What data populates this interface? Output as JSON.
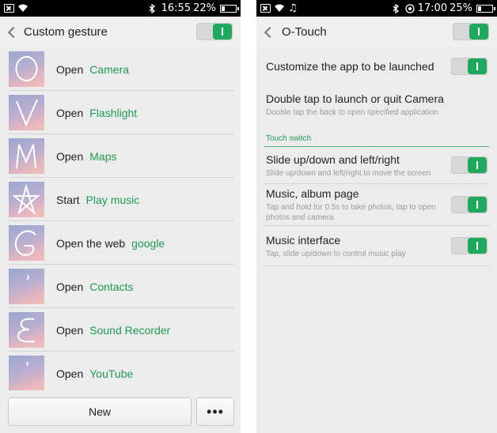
{
  "left": {
    "status": {
      "time": "16:55",
      "battery": "22%",
      "battery_level": 0.22
    },
    "header": {
      "title": "Custom gesture",
      "toggle_on": true
    },
    "gestures": [
      {
        "glyph": "O",
        "verb": "Open",
        "target": "Camera"
      },
      {
        "glyph": "V",
        "verb": "Open",
        "target": "Flashlight"
      },
      {
        "glyph": "M",
        "verb": "Open",
        "target": "Maps"
      },
      {
        "glyph": "star",
        "verb": "Start",
        "target": "Play music"
      },
      {
        "glyph": "G",
        "verb": "Open the web",
        "target": "google"
      },
      {
        "glyph": "comma",
        "verb": "Open",
        "target": "Contacts"
      },
      {
        "glyph": "E",
        "verb": "Open",
        "target": "Sound Recorder"
      },
      {
        "glyph": "tick",
        "verb": "Open",
        "target": "YouTube"
      }
    ],
    "buttons": {
      "new_label": "New",
      "more_label": "•••"
    }
  },
  "right": {
    "status": {
      "time": "17:00",
      "battery": "25%",
      "battery_level": 0.25
    },
    "header": {
      "title": "O-Touch",
      "toggle_on": true
    },
    "settings": [
      {
        "title": "Customize the app to be launched",
        "subtitle": "",
        "toggle_on": true
      },
      {
        "title": "Double tap to launch or quit Camera",
        "subtitle": "Double tap the back to open specified application"
      }
    ],
    "section_label": "Touch switch",
    "touch_settings": [
      {
        "title": "Slide up/down and left/right",
        "subtitle": "Slide up/down and left/right to move the screen",
        "toggle_on": true
      },
      {
        "title": "Music, album page",
        "subtitle": "Tap and hold for 0.5s to take photos, tap to open photos and camera",
        "toggle_on": true
      },
      {
        "title": "Music interface",
        "subtitle": "Tap, slide up/down to control music play",
        "toggle_on": true
      }
    ]
  },
  "colors": {
    "accent": "#1f9a54",
    "toggle_on": "#1fa85e"
  }
}
